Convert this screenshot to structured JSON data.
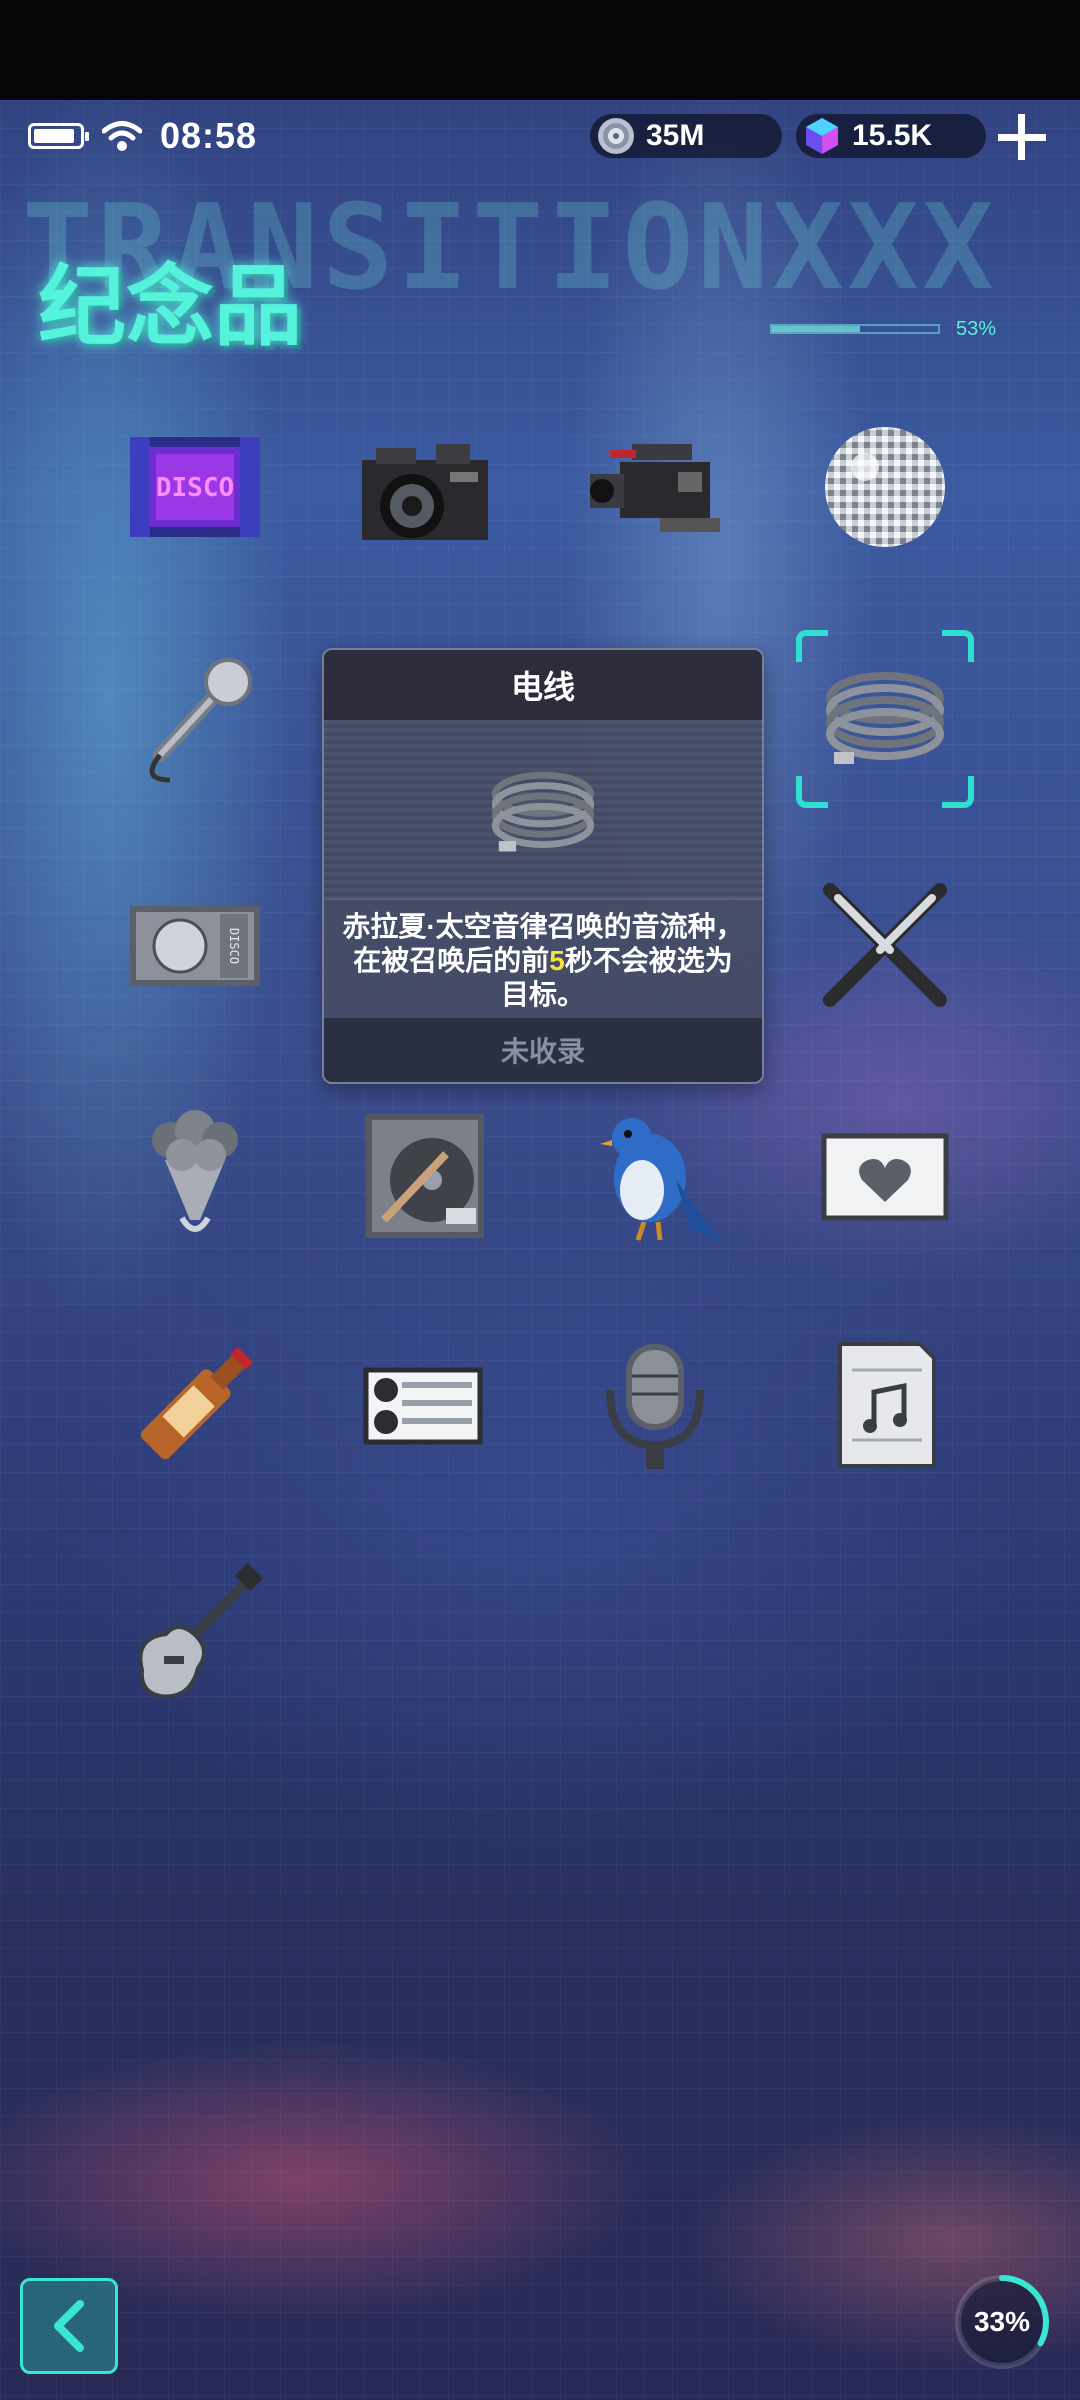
{
  "status_bar": {
    "time": "08:58",
    "battery_level": 0.9
  },
  "currencies": [
    {
      "icon": "disc-coin-icon",
      "value": "35M"
    },
    {
      "icon": "gem-cube-icon",
      "value": "15.5K"
    }
  ],
  "header": {
    "title": "纪念品",
    "decor_text": "TRANSITIONXXX",
    "decor_percent": "53%"
  },
  "items": [
    {
      "id": "disco-sign",
      "icon": "disco-sign-icon"
    },
    {
      "id": "camera",
      "icon": "camera-icon"
    },
    {
      "id": "video-camera",
      "icon": "video-camera-icon"
    },
    {
      "id": "disco-ball",
      "icon": "disco-ball-icon"
    },
    {
      "id": "microphone",
      "icon": "microphone-icon"
    },
    {
      "id": "cable",
      "icon": "cable-coil-icon",
      "selected": true
    },
    {
      "id": "disco-ticket",
      "icon": "disco-ticket-icon"
    },
    {
      "id": "lightsticks",
      "icon": "crossed-lightsticks-icon"
    },
    {
      "id": "bouquet",
      "icon": "flower-bouquet-icon"
    },
    {
      "id": "guitar-record",
      "icon": "guitar-record-icon"
    },
    {
      "id": "bluebird",
      "icon": "bluebird-icon"
    },
    {
      "id": "love-letter",
      "icon": "heart-envelope-icon"
    },
    {
      "id": "wine-bottle",
      "icon": "wine-bottle-icon"
    },
    {
      "id": "film-projector",
      "icon": "film-projector-icon"
    },
    {
      "id": "studio-mic",
      "icon": "studio-microphone-icon"
    },
    {
      "id": "sheet-music",
      "icon": "sheet-music-icon"
    },
    {
      "id": "electric-guitar",
      "icon": "electric-guitar-icon"
    }
  ],
  "tooltip": {
    "title": "电线",
    "desc_part1": "赤拉夏·太空音律召唤的音流种，在被召唤后的前",
    "desc_highlight": "5",
    "desc_part2": "秒不会被选为目标。",
    "footer": "未收录"
  },
  "progress": {
    "label": "33%",
    "value": 0.33
  },
  "colors": {
    "accent": "#38e6d2",
    "highlight": "#f6e23a"
  }
}
